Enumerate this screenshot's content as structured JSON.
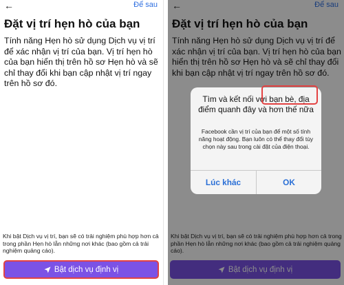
{
  "common": {
    "back_icon": "←",
    "skip_label": "Để sau",
    "title": "Đặt vị trí hẹn hò của bạn",
    "description": "Tính năng Hẹn hò sử dụng Dịch vụ vị trí để xác nhận vị trí của bạn. Vị trí hẹn hò của bạn hiển thị trên hồ sơ Hẹn hò và sẽ chỉ thay đổi khi bạn cập nhật vị trí ngay trên hồ sơ đó.",
    "footnote": "Khi bật Dịch vụ vị trí, bạn sẽ có trải nghiệm phù hợp hơn cả trong phần Hẹn hò lẫn những nơi khác (bao gồm cả trải nghiệm quảng cáo).",
    "cta_label": "Bật dịch vụ định vị",
    "cta_icon": "navigation-arrow-icon"
  },
  "dialog": {
    "title": "Tìm và kết nối với bạn bè, địa điểm quanh đây và hơn thế nữa",
    "message": "Facebook cần vị trí của bạn để một số tính năng hoạt động. Bạn luôn có thể thay đổi tùy chọn này sau trong cài đặt của điện thoại.",
    "later_label": "Lúc khác",
    "ok_label": "OK"
  },
  "colors": {
    "accent": "#7b52e6",
    "link": "#2d6ee0",
    "highlight_outline": "#e34242"
  }
}
